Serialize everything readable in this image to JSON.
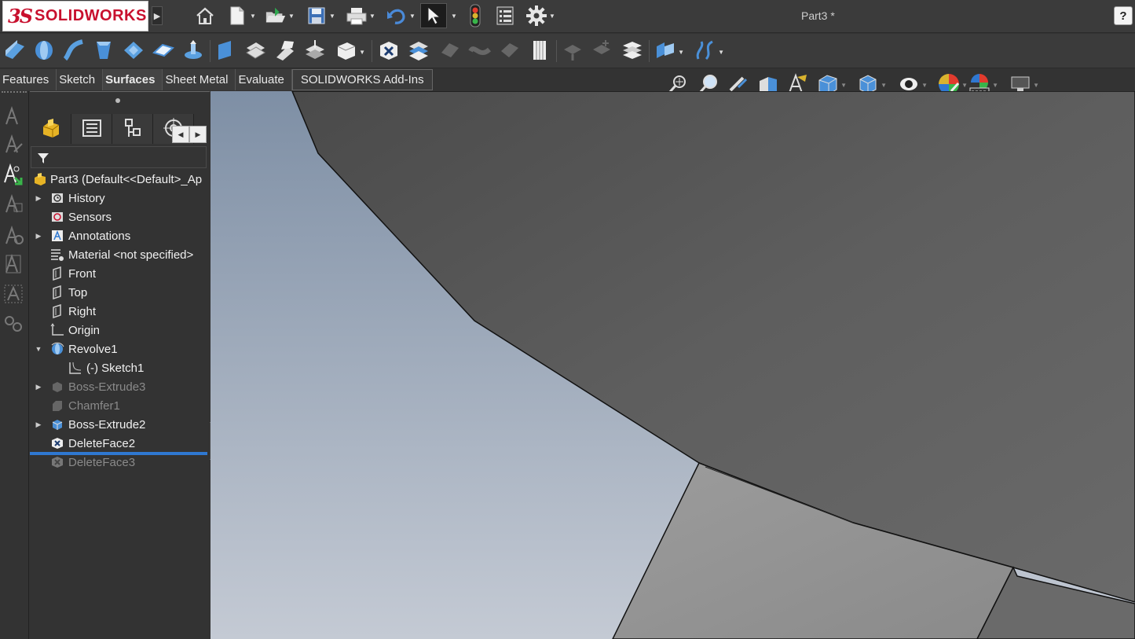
{
  "app": {
    "logo_mark": "3S",
    "logo_text": "SOLIDWORKS",
    "document_title": "Part3 *",
    "help_label": "?"
  },
  "quick_access": [
    {
      "name": "home-icon"
    },
    {
      "name": "new-document-icon"
    },
    {
      "name": "open-icon"
    },
    {
      "name": "save-icon"
    },
    {
      "name": "print-icon"
    },
    {
      "name": "undo-icon"
    },
    {
      "name": "select-icon"
    },
    {
      "name": "rebuild-icon"
    },
    {
      "name": "file-properties-icon"
    },
    {
      "name": "options-gear-icon"
    }
  ],
  "tabs": {
    "items": [
      {
        "label": "Features"
      },
      {
        "label": "Sketch"
      },
      {
        "label": "Surfaces"
      },
      {
        "label": "Sheet Metal"
      },
      {
        "label": "Evaluate"
      },
      {
        "label": "SOLIDWORKS Add-Ins"
      }
    ],
    "active": "Surfaces"
  },
  "feature_tree": {
    "root": "Part3  (Default<<Default>_Ap",
    "items": [
      {
        "label": "History",
        "expandable": true
      },
      {
        "label": "Sensors",
        "expandable": false
      },
      {
        "label": "Annotations",
        "expandable": true
      },
      {
        "label": "Material <not specified>",
        "expandable": false
      },
      {
        "label": "Front",
        "expandable": false
      },
      {
        "label": "Top",
        "expandable": false
      },
      {
        "label": "Right",
        "expandable": false
      },
      {
        "label": "Origin",
        "expandable": false
      },
      {
        "label": "Revolve1",
        "expandable": true,
        "expanded": true
      },
      {
        "label": "(-) Sketch1",
        "child": true
      },
      {
        "label": "Boss-Extrude3",
        "expandable": true,
        "suppressed": true
      },
      {
        "label": "Chamfer1",
        "suppressed": true
      },
      {
        "label": "Boss-Extrude2",
        "expandable": true
      },
      {
        "label": "DeleteFace2"
      },
      {
        "label": "DeleteFace3",
        "suppressed": true
      }
    ]
  },
  "colors": {
    "ui_background": "#3b3b3b",
    "rollback_bar": "#2f78d1",
    "viewport_top": "#7e8fa5",
    "viewport_bottom": "#c4cad4",
    "brand_red": "#c8102e"
  }
}
